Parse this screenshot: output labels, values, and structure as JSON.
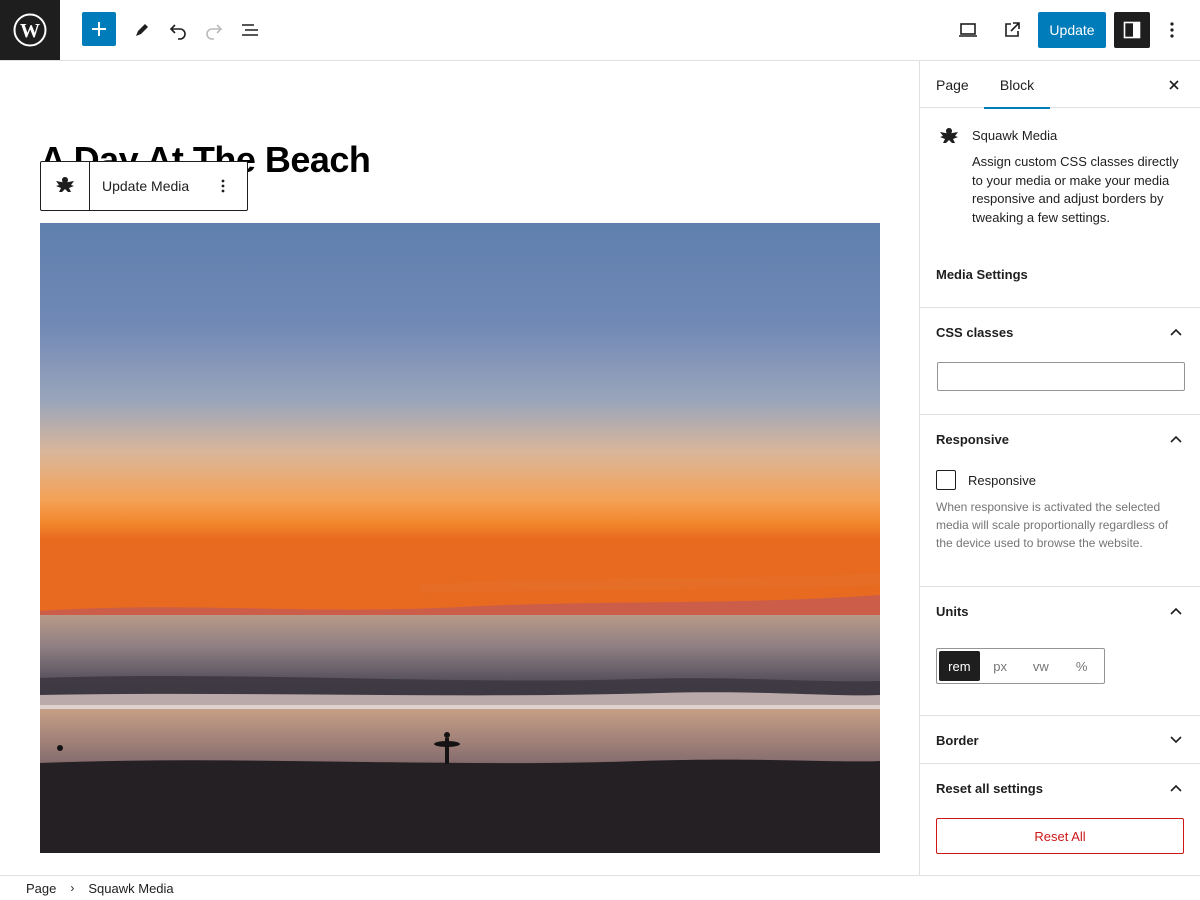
{
  "toolbar": {
    "update_label": "Update"
  },
  "editor": {
    "post_title": "A Day At The Beach",
    "block_toolbar": {
      "label": "Update Media"
    }
  },
  "sidebar": {
    "tabs": [
      {
        "label": "Page"
      },
      {
        "label": "Block"
      }
    ],
    "block_card": {
      "title": "Squawk Media",
      "description": "Assign custom CSS classes directly to your media or make your media responsive and adjust borders by tweaking a few settings.",
      "section_heading": "Media Settings"
    },
    "panels": {
      "css_classes": {
        "title": "CSS classes",
        "value": ""
      },
      "responsive": {
        "title": "Responsive",
        "checkbox_label": "Responsive",
        "checked": false,
        "help": "When responsive is activated the selected media will scale proportionally regardless of the device used to browse the website."
      },
      "units": {
        "title": "Units",
        "options": [
          "rem",
          "px",
          "vw",
          "%"
        ],
        "selected": "rem"
      },
      "border": {
        "title": "Border"
      },
      "reset": {
        "title": "Reset all settings",
        "button_label": "Reset All"
      }
    }
  },
  "footer": {
    "breadcrumbs": [
      "Page",
      "Squawk Media"
    ]
  },
  "colors": {
    "accent": "#007cba",
    "dark": "#1e1e1e",
    "danger": "#cc1818",
    "border": "#e0e0e0"
  }
}
